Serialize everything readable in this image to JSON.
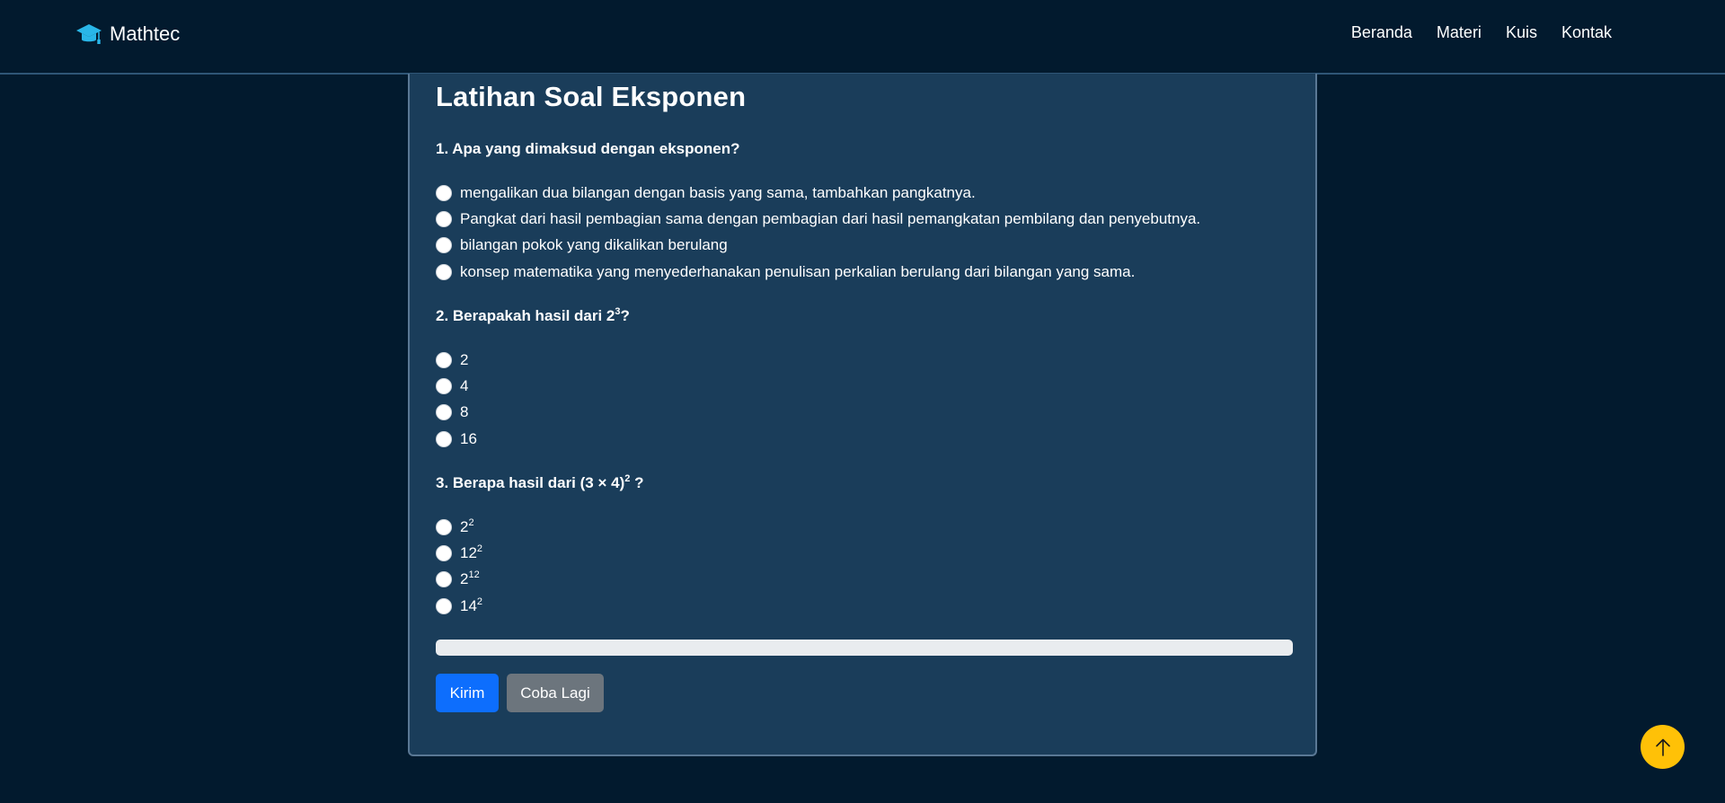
{
  "navbar": {
    "brand": "Mathtec",
    "brand_icon": "graduation-cap-icon",
    "links": [
      "Beranda",
      "Materi",
      "Kuis",
      "Kontak"
    ]
  },
  "quiz": {
    "title": "Latihan Soal Eksponen",
    "questions": [
      {
        "label": "1. Apa yang dimaksud dengan eksponen?",
        "options": [
          "mengalikan dua bilangan dengan basis yang sama, tambahkan pangkatnya.",
          "Pangkat dari hasil pembagian sama dengan pembagian dari hasil pemangkatan pembilang dan penyebutnya.",
          "bilangan pokok yang dikalikan berulang",
          "konsep matematika yang menyederhanakan penulisan perkalian berulang dari bilangan yang sama."
        ]
      },
      {
        "label_prefix": "2. Berapakah hasil dari 2",
        "label_sup": "3",
        "label_suffix": "?",
        "options": [
          "2",
          "4",
          "8",
          "16"
        ]
      },
      {
        "label_prefix": "3. Berapa hasil dari (3 × 4)",
        "label_sup": "2",
        "label_suffix": " ?",
        "options": [
          {
            "base": "2",
            "exp": "2"
          },
          {
            "base": "12",
            "exp": "2"
          },
          {
            "base": "2",
            "exp": "12"
          },
          {
            "base": "14",
            "exp": "2"
          }
        ]
      }
    ],
    "progress_percent": 0,
    "submit_label": "Kirim",
    "retry_label": "Coba Lagi"
  },
  "back_to_top_icon": "arrow-up-icon",
  "colors": {
    "background": "#021a2e",
    "card": "#1a3d5a",
    "primary": "#0d6efd",
    "secondary": "#6c757d",
    "accent": "#ffc107",
    "brand_icon": "#29b6e8"
  }
}
